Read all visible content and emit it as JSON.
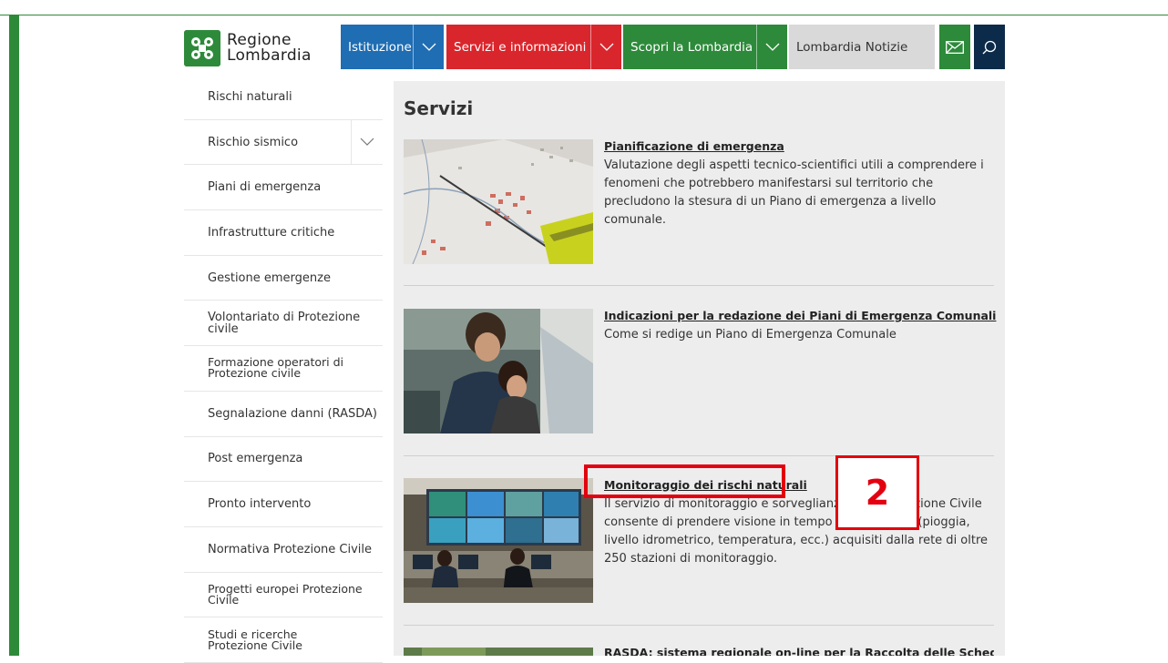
{
  "header": {
    "logo_line1": "Regione",
    "logo_line2": "Lombardia",
    "nav": [
      {
        "label": "Istituzione",
        "color": "#1f6db3"
      },
      {
        "label": "Servizi e informazioni",
        "color": "#d9262c"
      },
      {
        "label": "Scopri la Lombardia",
        "color": "#2d8a3a"
      },
      {
        "label": "Lombardia Notizie",
        "color": "#d9d9d9"
      }
    ],
    "mail_icon": "envelope-icon",
    "search_icon": "search-icon"
  },
  "sidebar": {
    "items": [
      {
        "label": "Rischi naturali"
      },
      {
        "label": "Rischio sismico"
      },
      {
        "label": "Piani di emergenza"
      },
      {
        "label": "Infrastrutture critiche"
      },
      {
        "label": "Gestione emergenze"
      },
      {
        "label": "Volontariato di Protezione civile"
      },
      {
        "label": "Formazione operatori di Protezione civile"
      },
      {
        "label": "Segnalazione danni (RASDA)"
      },
      {
        "label": "Post emergenza"
      },
      {
        "label": "Pronto intervento"
      },
      {
        "label": "Normativa Protezione Civile"
      },
      {
        "label": "Progetti europei Protezione Civile"
      },
      {
        "label": "Studi e ricerche Protezione Civile"
      }
    ]
  },
  "main": {
    "title": "Servizi",
    "services": [
      {
        "title": "Pianificazione di emergenza",
        "description": "Valutazione degli aspetti tecnico-scientifici utili a comprendere i fenomeni che potrebbero manifestarsi sul territorio che precludono la stesura di un Piano di emergenza a livello comunale."
      },
      {
        "title": "Indicazioni per la redazione dei Piani di Emergenza Comunali",
        "description": "Come si redige un Piano di Emergenza Comunale"
      },
      {
        "title": "Monitoraggio dei rischi naturali",
        "description": "Il servizio di monitoraggio e sorveglianza della Protezione Civile consente di prendere visione in tempo reale dei dati (pioggia, livello idrometrico, temperatura, ecc.) acquisiti dalla rete di oltre 250 stazioni di monitoraggio."
      },
      {
        "title": "RASDA: sistema regionale on-line per la Raccolta delle Schede Danni",
        "description": ""
      }
    ]
  },
  "annotation": {
    "step_number": "2",
    "color": "#e3000f"
  }
}
